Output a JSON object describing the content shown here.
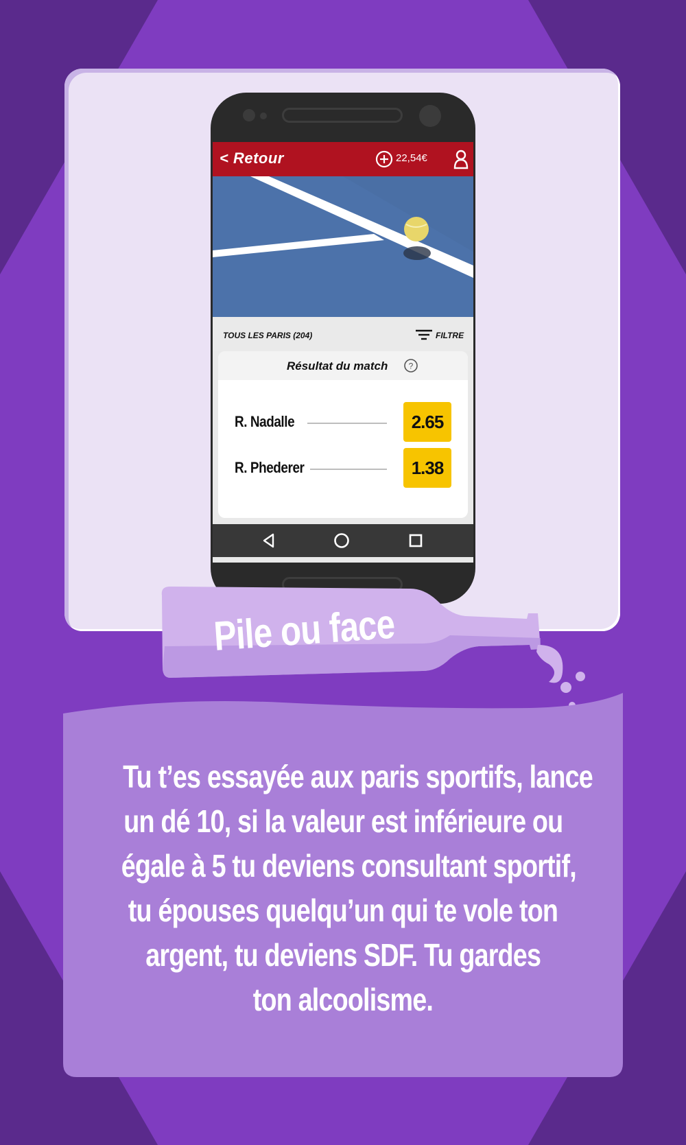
{
  "app": {
    "back_label": "< Retour",
    "balance": "22,54€",
    "add_funds_icon": "plus-circle-icon",
    "profile_icon": "user-icon",
    "all_bets_label": "TOUS LES PARIS (204)",
    "filter_label": "FILTRE",
    "market_title": "Résultat du match",
    "selections": [
      {
        "player": "R. Nadalle",
        "odds": "2.65"
      },
      {
        "player": "R. Phederer",
        "odds": "1.38"
      }
    ],
    "nav_icons": [
      "back-triangle-icon",
      "home-circle-icon",
      "recent-square-icon"
    ]
  },
  "bottle_label": "Pile ou face",
  "story_lines": [
    "Tu t’es essayée aux paris sportifs, lance",
    "un dé 10, si la valeur est inférieure ou",
    "égale à 5 tu deviens consultant sportif,",
    "tu épouses quelqu’un qui te vole ton",
    "argent, tu deviens SDF. Tu gardes",
    "ton alcoolisme."
  ],
  "colors": {
    "background_dark": "#5a2a8c",
    "background_mid": "#7f3cc0",
    "card_light": "#ebe2f5",
    "lower_card": "#a97fd8",
    "header_red": "#b01220",
    "odds_yellow": "#f7c400",
    "court_blue": "#4a6fa5"
  }
}
